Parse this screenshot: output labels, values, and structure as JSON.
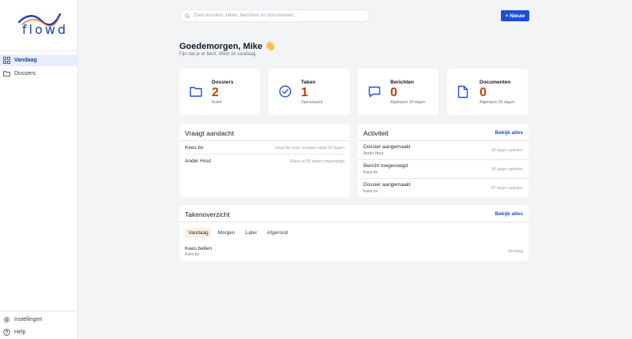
{
  "app": {
    "logo_text": "flowd",
    "brand_color": "#1d4ed8",
    "accent_color": "#c2410c"
  },
  "sidebar": {
    "items": [
      {
        "label": "Vandaag",
        "icon": "grid-icon",
        "active": true
      },
      {
        "label": "Dossiers",
        "icon": "folder-icon",
        "active": false
      }
    ],
    "bottom": [
      {
        "label": "Instellingen",
        "icon": "gear-icon"
      },
      {
        "label": "Help",
        "icon": "help-icon"
      }
    ]
  },
  "header": {
    "search_placeholder": "Zoek dossiers, taken, berichten en documenten...",
    "new_button": "+ Nieuw"
  },
  "greeting": {
    "title": "Goedemorgen, Mike 👋",
    "subtitle": "Fijn dat je er bent. Werk ze vandaag."
  },
  "stats": [
    {
      "label": "Dossiers",
      "value": "2",
      "sub": "Actief",
      "icon": "folder-icon"
    },
    {
      "label": "Taken",
      "value": "1",
      "sub": "Openstaand",
      "icon": "check-circle-icon"
    },
    {
      "label": "Berichten",
      "value": "0",
      "sub": "Afgelopen 30 dagen",
      "icon": "message-icon"
    },
    {
      "label": "Documenten",
      "value": "0",
      "sub": "Afgelopen 30 dagen",
      "icon": "document-icon"
    }
  ],
  "attention": {
    "title": "Vraagt aandacht",
    "rows": [
      {
        "name": "Kees bv",
        "status": "Volgende actie verlopen sinds 59 dagen"
      },
      {
        "name": "Ander Hout",
        "status": "Status al 58 dagen ongewijzigd"
      }
    ]
  },
  "activity": {
    "title": "Activiteit",
    "link": "Bekijk alles",
    "rows": [
      {
        "title": "Dossier aangemaakt",
        "sub": "Ander Hout",
        "time": "58 dagen geleden"
      },
      {
        "title": "Bericht toegevoegd",
        "sub": "Kees bv",
        "time": "58 dagen geleden"
      },
      {
        "title": "Dossier aangemaakt",
        "sub": "Kees bv",
        "time": "87 dagen geleden"
      }
    ]
  },
  "tasks": {
    "title": "Takenoverzicht",
    "link": "Bekijk alles",
    "tabs": [
      "Vandaag",
      "Morgen",
      "Later",
      "Afgerond"
    ],
    "active_tab": "Vandaag",
    "rows": [
      {
        "title": "Kees bellen",
        "sub": "Kees bv",
        "due": "Vandaag"
      }
    ]
  }
}
